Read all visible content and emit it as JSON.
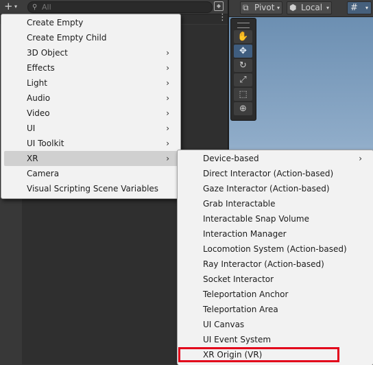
{
  "hierarchy": {
    "add_button": {
      "plus": "+",
      "caret": "▾"
    },
    "search": {
      "icon": "search-icon",
      "placeholder": "All",
      "value": ""
    },
    "scene_button_icon": "scene-icon",
    "kebab": "⋮"
  },
  "scene_toolbar": {
    "pivot": {
      "icon": "pivot-icon",
      "label": "Pivot",
      "caret": "▾"
    },
    "local": {
      "icon": "cube-icon",
      "label": "Local",
      "caret": "▾"
    },
    "grid": {
      "icon": "grid-snap-icon",
      "caret": "▾"
    }
  },
  "tool_palette": {
    "tools": [
      {
        "name": "hand-tool",
        "glyph": "✋",
        "active": false
      },
      {
        "name": "move-tool",
        "glyph": "✥",
        "active": true
      },
      {
        "name": "rotate-tool",
        "glyph": "↻",
        "active": false
      },
      {
        "name": "scale-tool",
        "glyph": "⤢",
        "active": false
      },
      {
        "name": "rect-tool",
        "glyph": "⬚",
        "active": false
      },
      {
        "name": "transform-tool",
        "glyph": "⊕",
        "active": false
      }
    ]
  },
  "create_menu": {
    "items": [
      {
        "label": "Create Empty",
        "submenu": false
      },
      {
        "label": "Create Empty Child",
        "submenu": false
      },
      {
        "label": "3D Object",
        "submenu": true
      },
      {
        "label": "Effects",
        "submenu": true
      },
      {
        "label": "Light",
        "submenu": true
      },
      {
        "label": "Audio",
        "submenu": true
      },
      {
        "label": "Video",
        "submenu": true
      },
      {
        "label": "UI",
        "submenu": true
      },
      {
        "label": "UI Toolkit",
        "submenu": true
      },
      {
        "label": "XR",
        "submenu": true,
        "hover": true
      },
      {
        "label": "Camera",
        "submenu": false
      },
      {
        "label": "Visual Scripting Scene Variables",
        "submenu": false
      }
    ]
  },
  "xr_submenu": {
    "items": [
      {
        "label": "Device-based",
        "submenu": true
      },
      {
        "label": "Direct Interactor (Action-based)",
        "submenu": false
      },
      {
        "label": "Gaze Interactor (Action-based)",
        "submenu": false
      },
      {
        "label": "Grab Interactable",
        "submenu": false
      },
      {
        "label": "Interactable Snap Volume",
        "submenu": false
      },
      {
        "label": "Interaction Manager",
        "submenu": false
      },
      {
        "label": "Locomotion System (Action-based)",
        "submenu": false
      },
      {
        "label": "Ray Interactor (Action-based)",
        "submenu": false
      },
      {
        "label": "Socket Interactor",
        "submenu": false
      },
      {
        "label": "Teleportation Anchor",
        "submenu": false
      },
      {
        "label": "Teleportation Area",
        "submenu": false
      },
      {
        "label": "UI Canvas",
        "submenu": false
      },
      {
        "label": "UI Event System",
        "submenu": false
      },
      {
        "label": "XR Origin (VR)",
        "submenu": false,
        "highlighted": true
      }
    ],
    "arrow": "›"
  },
  "colors": {
    "highlight_border": "#e2001a",
    "menu_background": "#f2f2f2",
    "active_tool": "#3f5d7f"
  }
}
